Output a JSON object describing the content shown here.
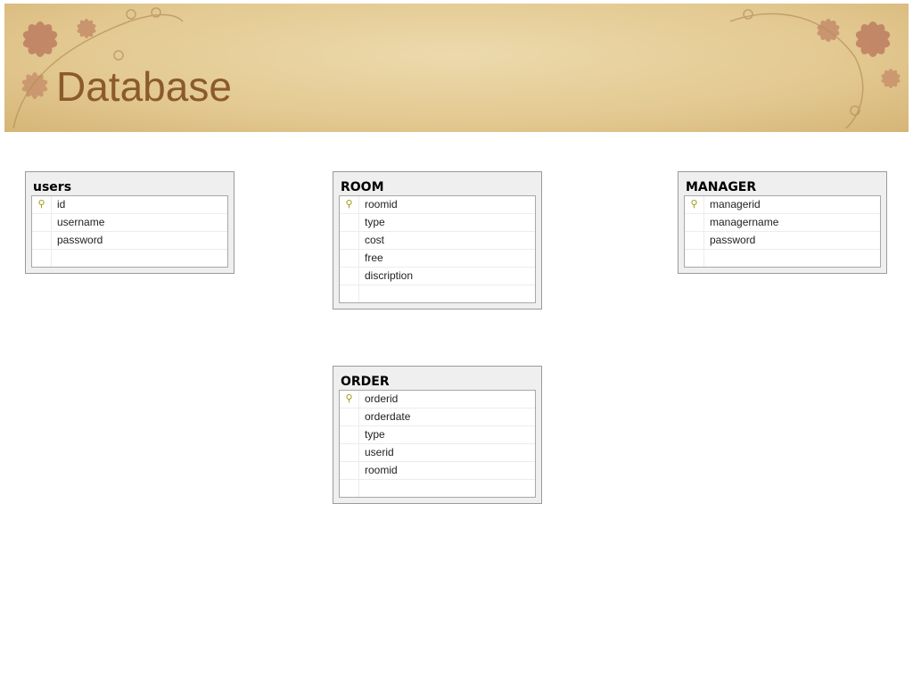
{
  "slide": {
    "title": "Database"
  },
  "tables": [
    {
      "name": "users",
      "columns": [
        {
          "name": "id",
          "pk": true
        },
        {
          "name": "username"
        },
        {
          "name": "password"
        }
      ]
    },
    {
      "name": "ROOM",
      "columns": [
        {
          "name": "roomid",
          "pk": true
        },
        {
          "name": "type"
        },
        {
          "name": "cost"
        },
        {
          "name": "free"
        },
        {
          "name": "discription"
        }
      ]
    },
    {
      "name": "MANAGER",
      "columns": [
        {
          "name": "managerid",
          "pk": true
        },
        {
          "name": "managername"
        },
        {
          "name": "password"
        }
      ]
    },
    {
      "name": "ORDER",
      "columns": [
        {
          "name": "orderid",
          "pk": true
        },
        {
          "name": "orderdate"
        },
        {
          "name": "type"
        },
        {
          "name": "userid"
        },
        {
          "name": "roomid"
        }
      ]
    }
  ],
  "icons": {
    "primary_key": "key-icon"
  }
}
